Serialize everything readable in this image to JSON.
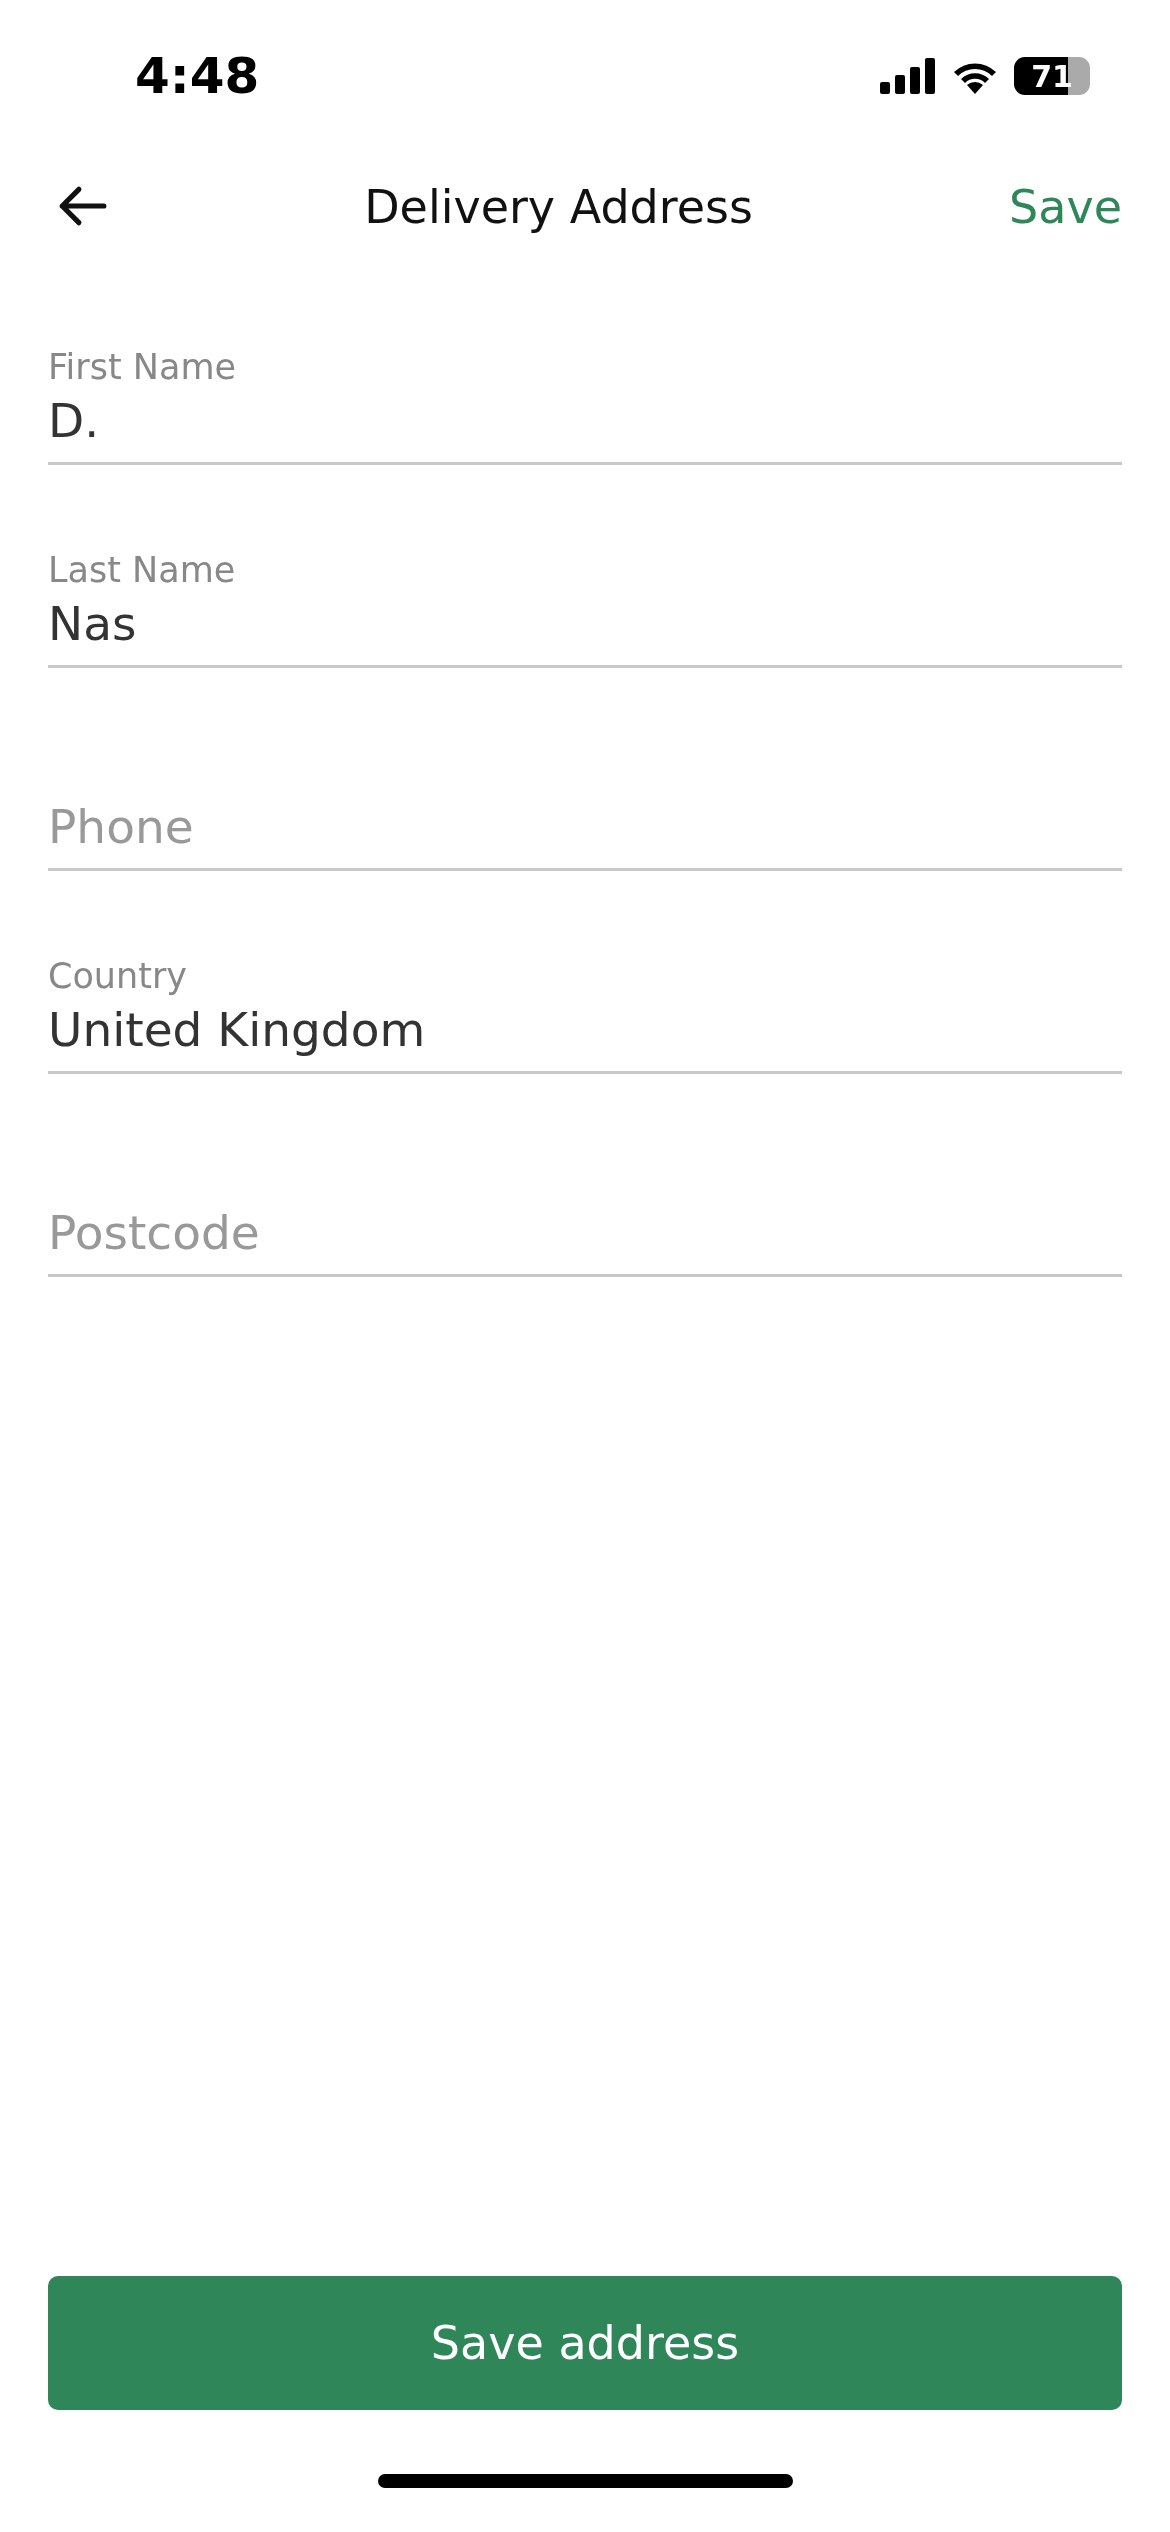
{
  "status_bar": {
    "time": "4:48",
    "battery": "71"
  },
  "header": {
    "title": "Delivery Address",
    "action": "Save"
  },
  "fields": [
    {
      "label": "First Name",
      "value": "D."
    },
    {
      "label": "Last Name",
      "value": "Nas"
    },
    {
      "placeholder": "Phone"
    },
    {
      "label": "Country",
      "value": "United Kingdom"
    },
    {
      "placeholder": "Postcode"
    }
  ],
  "button": "Save address"
}
